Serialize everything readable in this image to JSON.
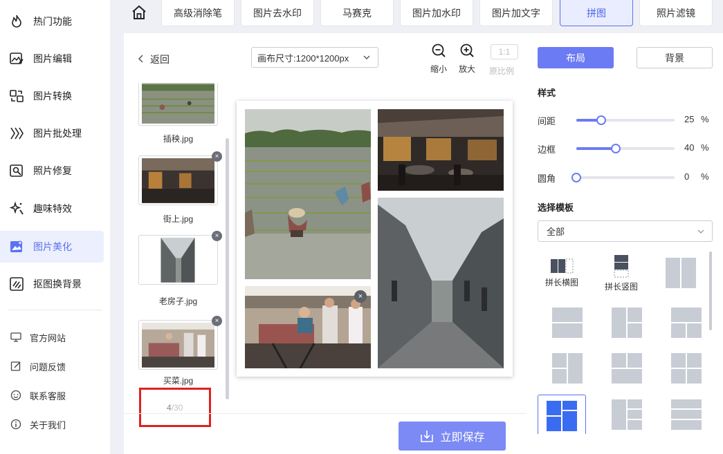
{
  "sidebar": {
    "items": [
      {
        "label": "热门功能",
        "icon": "fire-icon"
      },
      {
        "label": "图片编辑",
        "icon": "image-edit-icon"
      },
      {
        "label": "图片转换",
        "icon": "convert-icon"
      },
      {
        "label": "图片批处理",
        "icon": "batch-icon"
      },
      {
        "label": "照片修复",
        "icon": "photo-repair-icon"
      },
      {
        "label": "趣味特效",
        "icon": "sparkle-icon"
      },
      {
        "label": "图片美化",
        "icon": "beautify-icon"
      },
      {
        "label": "抠图换背景",
        "icon": "cutout-icon"
      }
    ],
    "active_index": 6,
    "links": [
      {
        "label": "官方网站",
        "icon": "monitor-icon"
      },
      {
        "label": "问题反馈",
        "icon": "feedback-icon"
      },
      {
        "label": "联系客服",
        "icon": "support-icon"
      },
      {
        "label": "关于我们",
        "icon": "info-icon"
      }
    ]
  },
  "tabs": [
    {
      "label": "高级消除笔"
    },
    {
      "label": "图片去水印"
    },
    {
      "label": "马赛克"
    },
    {
      "label": "图片加水印"
    },
    {
      "label": "图片加文字"
    },
    {
      "label": "拼图"
    },
    {
      "label": "照片滤镜"
    }
  ],
  "active_tab": 5,
  "editor": {
    "back_label": "返回",
    "canvas_size": "画布尺寸:1200*1200px",
    "zoom_out": "缩小",
    "zoom_in": "放大",
    "ratio_box": "1:1",
    "ratio_label": "原比例",
    "thumbnails": [
      {
        "name": "插秧.jpg"
      },
      {
        "name": "街上.jpg"
      },
      {
        "name": "老房子.jpg"
      },
      {
        "name": "买菜.jpg"
      }
    ],
    "counter_current": "4",
    "counter_total": "/30",
    "save_label": "立即保存"
  },
  "panel": {
    "layout_label": "布局",
    "background_label": "背景",
    "style_title": "样式",
    "sliders": [
      {
        "label": "间距",
        "value": "25",
        "unit": "%",
        "fraction": 0.25
      },
      {
        "label": "边框",
        "value": "40",
        "unit": "%",
        "fraction": 0.4
      },
      {
        "label": "圆角",
        "value": "0",
        "unit": "%",
        "fraction": 0
      }
    ],
    "template_title": "选择模板",
    "template_filter": "全部",
    "templates": [
      {
        "label": "拼长横图"
      },
      {
        "label": "拼长竖图"
      }
    ]
  },
  "colors": {
    "accent": "#6b7bf3",
    "active_tab_bg": "#e9edff",
    "highlight_box": "#e02020"
  }
}
